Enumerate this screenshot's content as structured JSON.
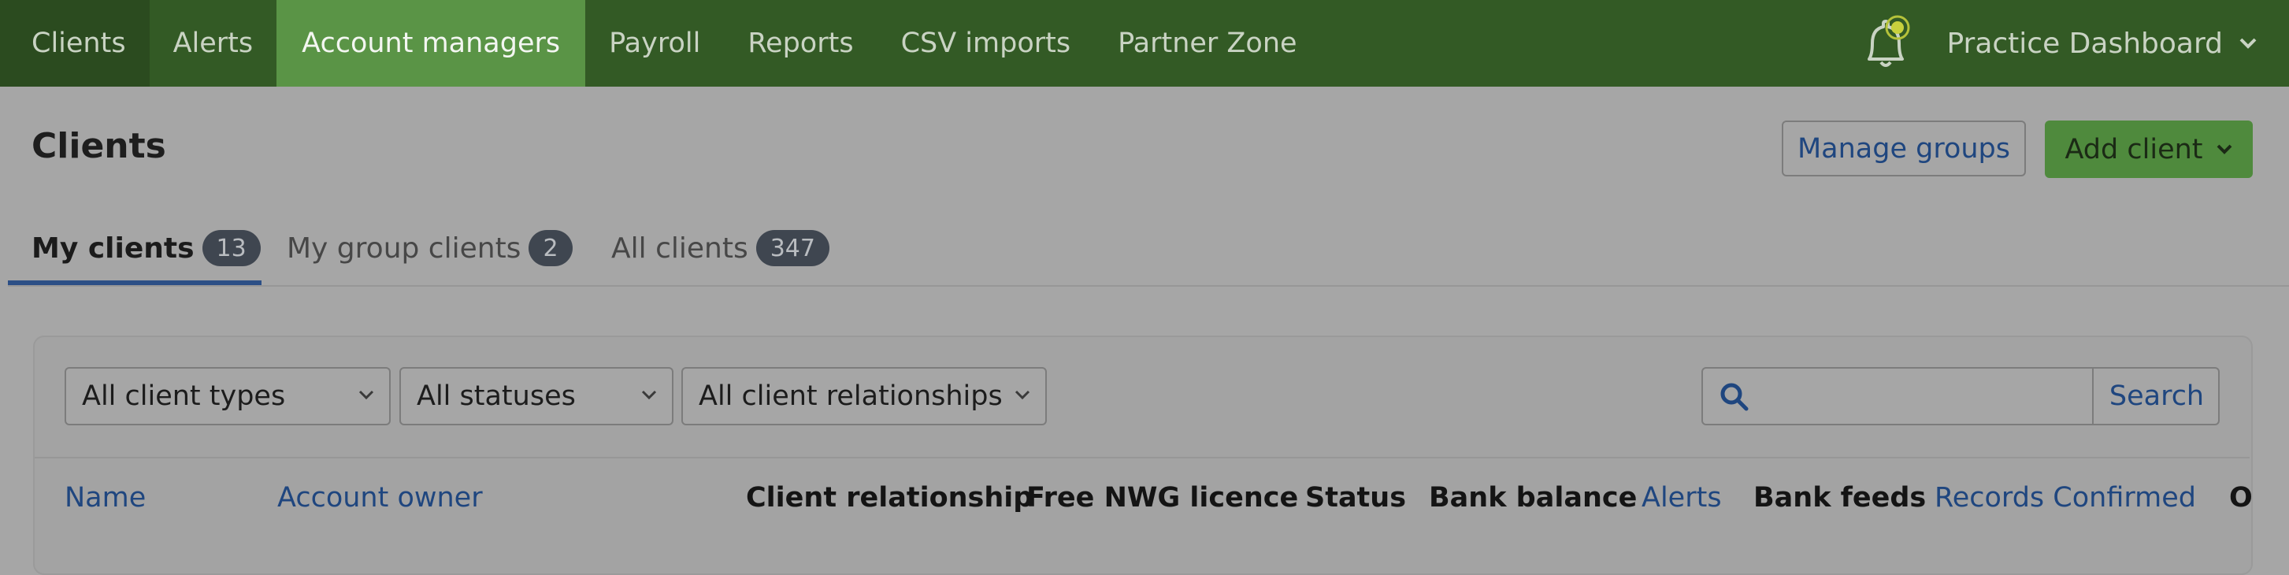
{
  "nav": {
    "items": [
      "Clients",
      "Alerts",
      "Account managers",
      "Payroll",
      "Reports",
      "CSV imports",
      "Partner Zone"
    ],
    "practice_label": "Practice Dashboard"
  },
  "header": {
    "title": "Clients",
    "manage_groups": "Manage groups",
    "add_client": "Add client"
  },
  "tabs": [
    {
      "label": "My clients",
      "count": "13"
    },
    {
      "label": "My group clients",
      "count": "2"
    },
    {
      "label": "All clients",
      "count": "347"
    }
  ],
  "filters": {
    "client_types": "All client types",
    "statuses": "All statuses",
    "relationships": "All client relationships",
    "search_placeholder": "",
    "search_button": "Search"
  },
  "columns": {
    "name": "Name",
    "account_owner": "Account owner",
    "client_relationship": "Client relationship",
    "free_licence": "Free NWG licence",
    "status": "Status",
    "bank_balance": "Bank balance",
    "alerts": "Alerts",
    "bank_feeds": "Bank feeds",
    "records_confirmed": "Records Confirmed",
    "overflow": "O"
  },
  "colors": {
    "nav_bg": "#335a25",
    "nav_active": "#5a9446",
    "accent_blue": "#1f467f",
    "add_button": "#4f8a3d",
    "badge_bg": "#3f4650"
  }
}
